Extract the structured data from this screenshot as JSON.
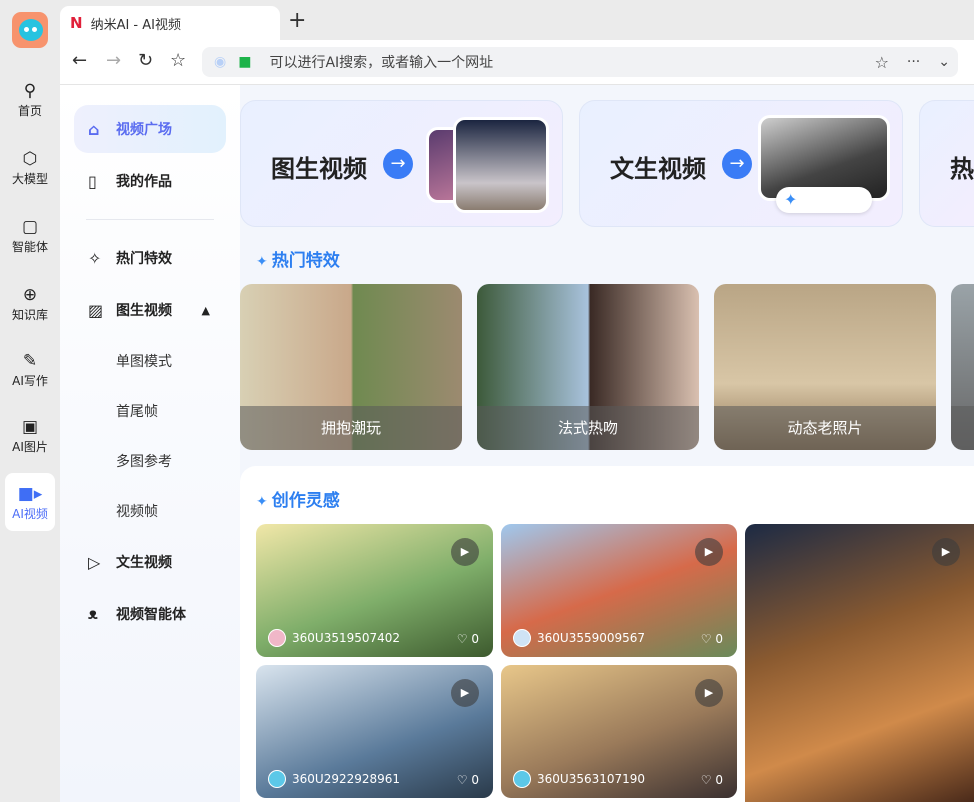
{
  "browser": {
    "tab_title": "纳米AI - AI视频",
    "new_tab": "+",
    "address_placeholder": "可以进行AI搜索，或者输入一个网址"
  },
  "rail": [
    {
      "label": "首页",
      "icon": "search-icon"
    },
    {
      "label": "大模型",
      "icon": "cube-icon"
    },
    {
      "label": "智能体",
      "icon": "agent-icon"
    },
    {
      "label": "知识库",
      "icon": "bulb-icon"
    },
    {
      "label": "AI写作",
      "icon": "pen-icon"
    },
    {
      "label": "AI图片",
      "icon": "image-icon"
    },
    {
      "label": "AI视频",
      "icon": "video-icon",
      "active": true
    }
  ],
  "sidebar": {
    "items": [
      {
        "label": "视频广场",
        "icon": "home-icon"
      },
      {
        "label": "我的作品",
        "icon": "bookmark-icon"
      },
      {
        "label": "热门特效",
        "icon": "magic-icon"
      },
      {
        "label": "图生视频",
        "icon": "image-plus-icon"
      },
      {
        "label": "单图模式"
      },
      {
        "label": "首尾帧"
      },
      {
        "label": "多图参考"
      },
      {
        "label": "视频帧"
      },
      {
        "label": "文生视频",
        "icon": "video-plus-icon"
      },
      {
        "label": "视频智能体",
        "icon": "bear-icon"
      }
    ]
  },
  "banners": [
    {
      "title": "图生视频"
    },
    {
      "title": "文生视频"
    },
    {
      "title": "热"
    }
  ],
  "hot_effects": {
    "title": "热门特效",
    "items": [
      "拥抱潮玩",
      "法式热吻",
      "动态老照片",
      ""
    ]
  },
  "inspiration": {
    "title": "创作灵感",
    "cards": [
      {
        "user": "360U3519507402",
        "likes": "0"
      },
      {
        "user": "360U3559009567",
        "likes": "0"
      },
      {
        "user": "360U2922928961",
        "likes": "0"
      },
      {
        "user": "360U3563107190",
        "likes": "0"
      }
    ]
  },
  "colors": {
    "accent": "#2d7ff0",
    "active_nav": "#5a6cf0"
  }
}
